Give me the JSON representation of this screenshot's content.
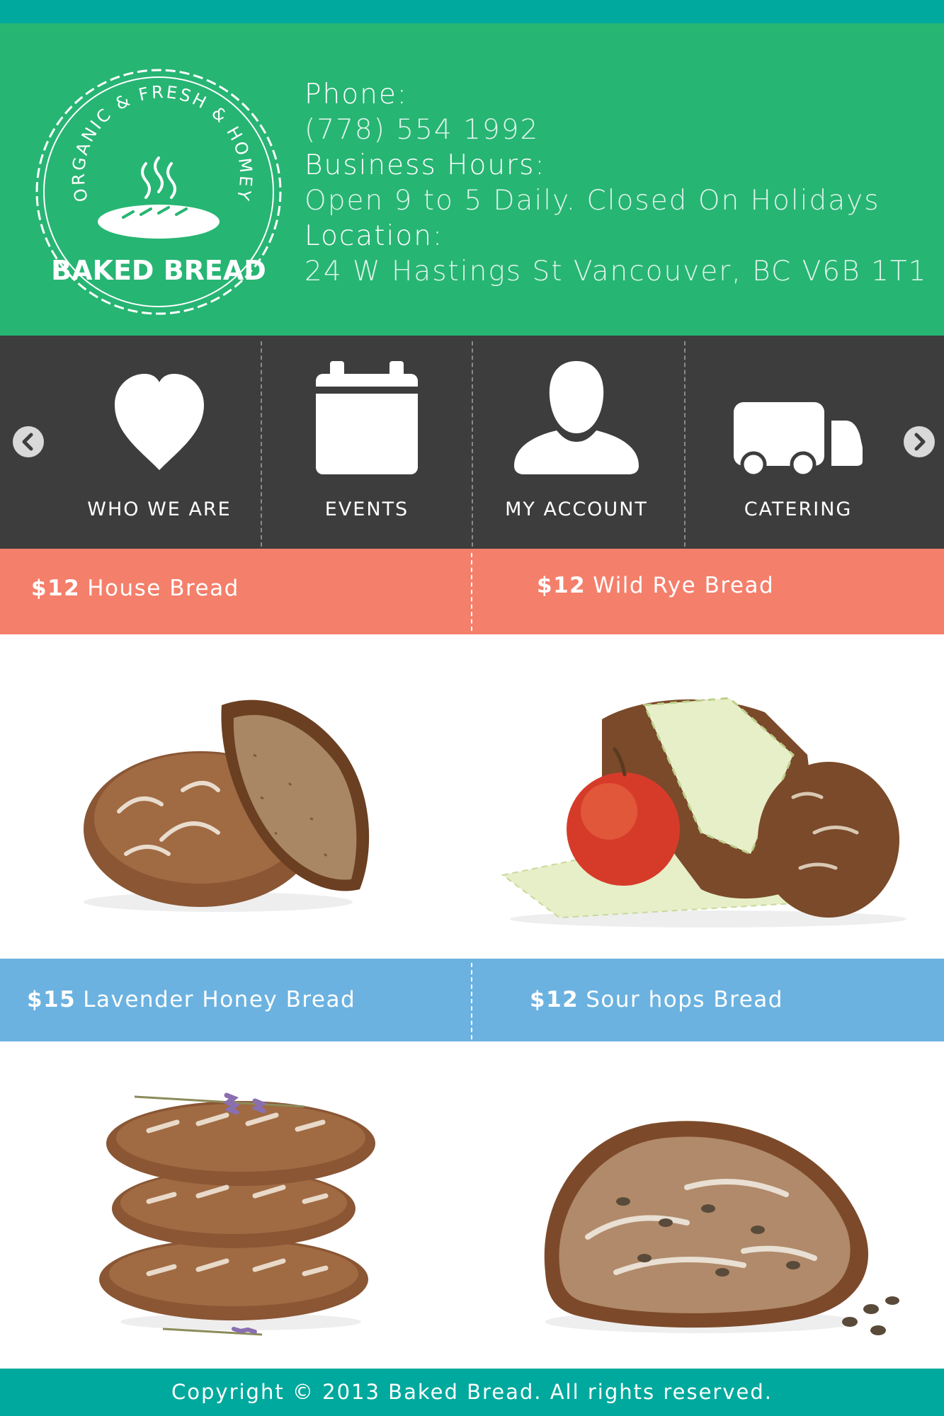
{
  "logo": {
    "arc_text": "ORGANIC & FRESH & HOMEY",
    "brand_name": "BAKED BREAD"
  },
  "contact": {
    "phone_label": "Phone:",
    "phone_value": "(778) 554 1992",
    "hours_label": "Business Hours:",
    "hours_value": "Open 9 to 5 Daily. Closed On Holidays",
    "location_label": "Location:",
    "location_value": "24 W Hastings St Vancouver, BC V6B 1T1"
  },
  "nav": {
    "items": [
      {
        "label": "WHO WE ARE",
        "icon": "heart-icon"
      },
      {
        "label": "EVENTS",
        "icon": "calendar-icon"
      },
      {
        "label": "MY ACCOUNT",
        "icon": "user-icon"
      },
      {
        "label": "CATERING",
        "icon": "truck-icon"
      }
    ]
  },
  "products": [
    {
      "price": "$12",
      "name": "House Bread"
    },
    {
      "price": "$12",
      "name": "Wild Rye Bread"
    },
    {
      "price": "$15",
      "name": "Lavender Honey Bread"
    },
    {
      "price": "$12",
      "name": "Sour hops Bread"
    }
  ],
  "footer": {
    "copyright": "Copyright © 2013 Baked Bread. All rights reserved."
  },
  "colors": {
    "top_stripe": "#00a99d",
    "header_bg": "#27b573",
    "nav_bg": "#3d3d3d",
    "salmon_band": "#f47f6b",
    "blue_band": "#6bb2e0",
    "footer_bg": "#00a99d"
  }
}
